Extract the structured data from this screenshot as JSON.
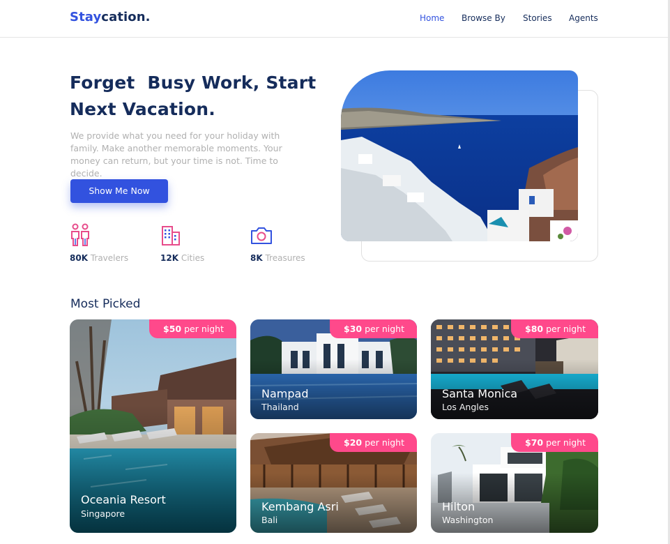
{
  "brand": {
    "part1": "Stay",
    "part2": "cation."
  },
  "nav": {
    "items": [
      {
        "label": "Home",
        "active": true
      },
      {
        "label": "Browse By",
        "active": false
      },
      {
        "label": "Stories",
        "active": false
      },
      {
        "label": "Agents",
        "active": false
      }
    ]
  },
  "hero": {
    "title_line1": "Forget  Busy Work, Start",
    "title_line2": "Next Vacation.",
    "description": "We provide what you need for your holiday with family. Make another memorable moments. Your money can return, but your time is not. Time to decide.",
    "cta_label": "Show Me Now",
    "stats": [
      {
        "value": "80K",
        "label": "Travelers",
        "icon": "travelers-icon"
      },
      {
        "value": "12K",
        "label": "Cities",
        "icon": "cities-icon"
      },
      {
        "value": "8K",
        "label": "Treasures",
        "icon": "camera-icon"
      }
    ]
  },
  "most_picked": {
    "title": "Most Picked",
    "price_suffix": "per night",
    "items": [
      {
        "price": "$50",
        "name": "Oceania Resort",
        "location": "Singapore"
      },
      {
        "price": "$30",
        "name": "Nampad",
        "location": "Thailand"
      },
      {
        "price": "$80",
        "name": "Santa Monica",
        "location": "Los Angles"
      },
      {
        "price": "$20",
        "name": "Kembang Asri",
        "location": "Bali"
      },
      {
        "price": "$70",
        "name": "Hilton",
        "location": "Washington"
      }
    ]
  },
  "colors": {
    "primary": "#3252df",
    "navy": "#152c5b",
    "accent_pink": "#ff498b",
    "muted_text": "#b0b0b0"
  }
}
